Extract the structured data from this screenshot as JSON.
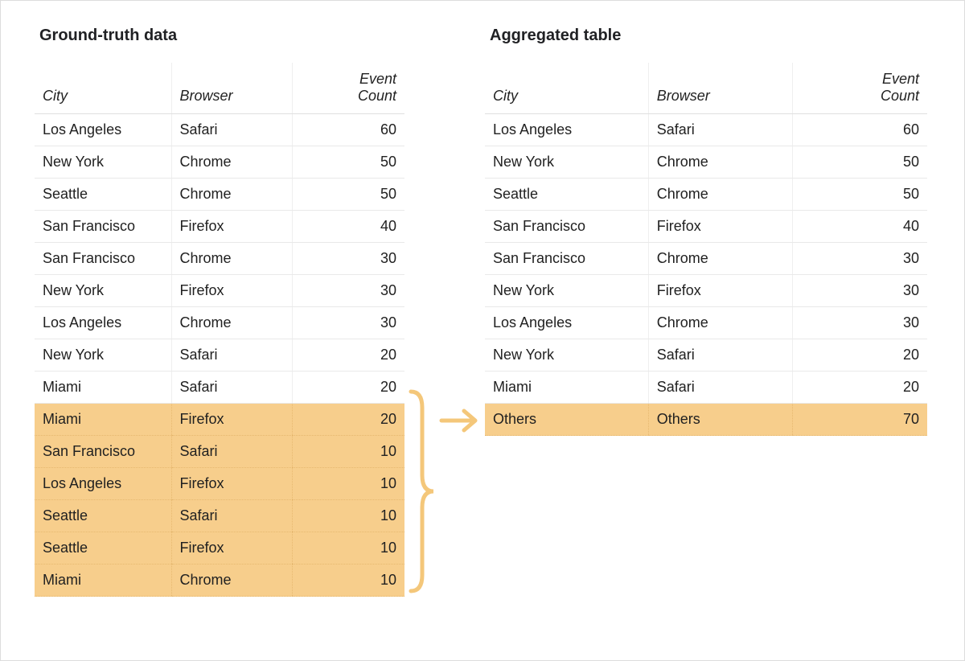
{
  "colors": {
    "highlight": "#f7ce8c",
    "arrow": "#f4c77a"
  },
  "left": {
    "title": "Ground-truth data",
    "columns": {
      "city": "City",
      "browser": "Browser",
      "count": "Event\nCount"
    },
    "rows": [
      {
        "city": "Los Angeles",
        "browser": "Safari",
        "count": 60,
        "highlight": false
      },
      {
        "city": "New York",
        "browser": "Chrome",
        "count": 50,
        "highlight": false
      },
      {
        "city": "Seattle",
        "browser": "Chrome",
        "count": 50,
        "highlight": false
      },
      {
        "city": "San Francisco",
        "browser": "Firefox",
        "count": 40,
        "highlight": false
      },
      {
        "city": "San Francisco",
        "browser": "Chrome",
        "count": 30,
        "highlight": false
      },
      {
        "city": "New York",
        "browser": "Firefox",
        "count": 30,
        "highlight": false
      },
      {
        "city": "Los Angeles",
        "browser": "Chrome",
        "count": 30,
        "highlight": false
      },
      {
        "city": "New York",
        "browser": "Safari",
        "count": 20,
        "highlight": false
      },
      {
        "city": "Miami",
        "browser": "Safari",
        "count": 20,
        "highlight": false
      },
      {
        "city": "Miami",
        "browser": "Firefox",
        "count": 20,
        "highlight": true
      },
      {
        "city": "San Francisco",
        "browser": "Safari",
        "count": 10,
        "highlight": true
      },
      {
        "city": "Los Angeles",
        "browser": "Firefox",
        "count": 10,
        "highlight": true
      },
      {
        "city": "Seattle",
        "browser": "Safari",
        "count": 10,
        "highlight": true
      },
      {
        "city": "Seattle",
        "browser": "Firefox",
        "count": 10,
        "highlight": true
      },
      {
        "city": "Miami",
        "browser": "Chrome",
        "count": 10,
        "highlight": true
      }
    ]
  },
  "right": {
    "title": "Aggregated table",
    "columns": {
      "city": "City",
      "browser": "Browser",
      "count": "Event\nCount"
    },
    "rows": [
      {
        "city": "Los Angeles",
        "browser": "Safari",
        "count": 60,
        "highlight": false
      },
      {
        "city": "New York",
        "browser": "Chrome",
        "count": 50,
        "highlight": false
      },
      {
        "city": "Seattle",
        "browser": "Chrome",
        "count": 50,
        "highlight": false
      },
      {
        "city": "San Francisco",
        "browser": "Firefox",
        "count": 40,
        "highlight": false
      },
      {
        "city": "San Francisco",
        "browser": "Chrome",
        "count": 30,
        "highlight": false
      },
      {
        "city": "New York",
        "browser": "Firefox",
        "count": 30,
        "highlight": false
      },
      {
        "city": "Los Angeles",
        "browser": "Chrome",
        "count": 30,
        "highlight": false
      },
      {
        "city": "New York",
        "browser": "Safari",
        "count": 20,
        "highlight": false
      },
      {
        "city": "Miami",
        "browser": "Safari",
        "count": 20,
        "highlight": false
      },
      {
        "city": "Others",
        "browser": "Others",
        "count": 70,
        "highlight": true
      }
    ]
  }
}
